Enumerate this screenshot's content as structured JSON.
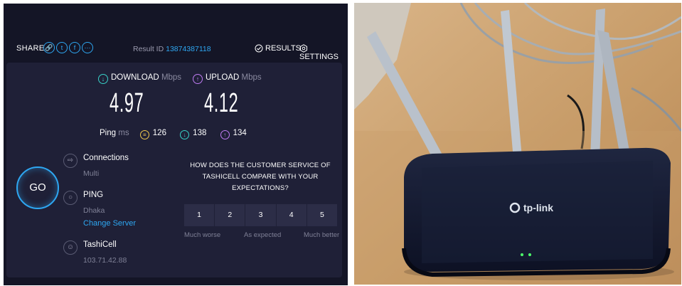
{
  "share": {
    "label": "SHARE",
    "icons": [
      "link-icon",
      "twitter-icon",
      "facebook-icon",
      "more-icon"
    ]
  },
  "result": {
    "prefix": "Result ID",
    "id": "13874387118"
  },
  "nav": {
    "results": "RESULTS",
    "settings": "SETTINGS"
  },
  "download": {
    "label": "DOWNLOAD",
    "unit": "Mbps",
    "value": "4.97"
  },
  "upload": {
    "label": "UPLOAD",
    "unit": "Mbps",
    "value": "4.12"
  },
  "ping": {
    "label": "Ping",
    "unit": "ms",
    "idle": "126",
    "download": "138",
    "upload": "134"
  },
  "go_label": "GO",
  "connections": {
    "title": "Connections",
    "value": "Multi"
  },
  "server": {
    "title": "PING",
    "location": "Dhaka",
    "change": "Change Server"
  },
  "provider": {
    "name": "TashiCell",
    "ip": "103.71.42.88"
  },
  "survey": {
    "question": "HOW DOES THE CUSTOMER SERVICE OF TASHICELL COMPARE WITH YOUR EXPECTATIONS?",
    "options": [
      "1",
      "2",
      "3",
      "4",
      "5"
    ],
    "low": "Much worse",
    "mid": "As expected",
    "high": "Much better"
  },
  "photo": {
    "brand": "tp-link"
  },
  "colors": {
    "background": "#141526",
    "card": "#1f2037",
    "accent": "#2ea7f2",
    "download": "#38d1c8",
    "upload": "#c07cf4",
    "ping_idle": "#f2c94c"
  }
}
